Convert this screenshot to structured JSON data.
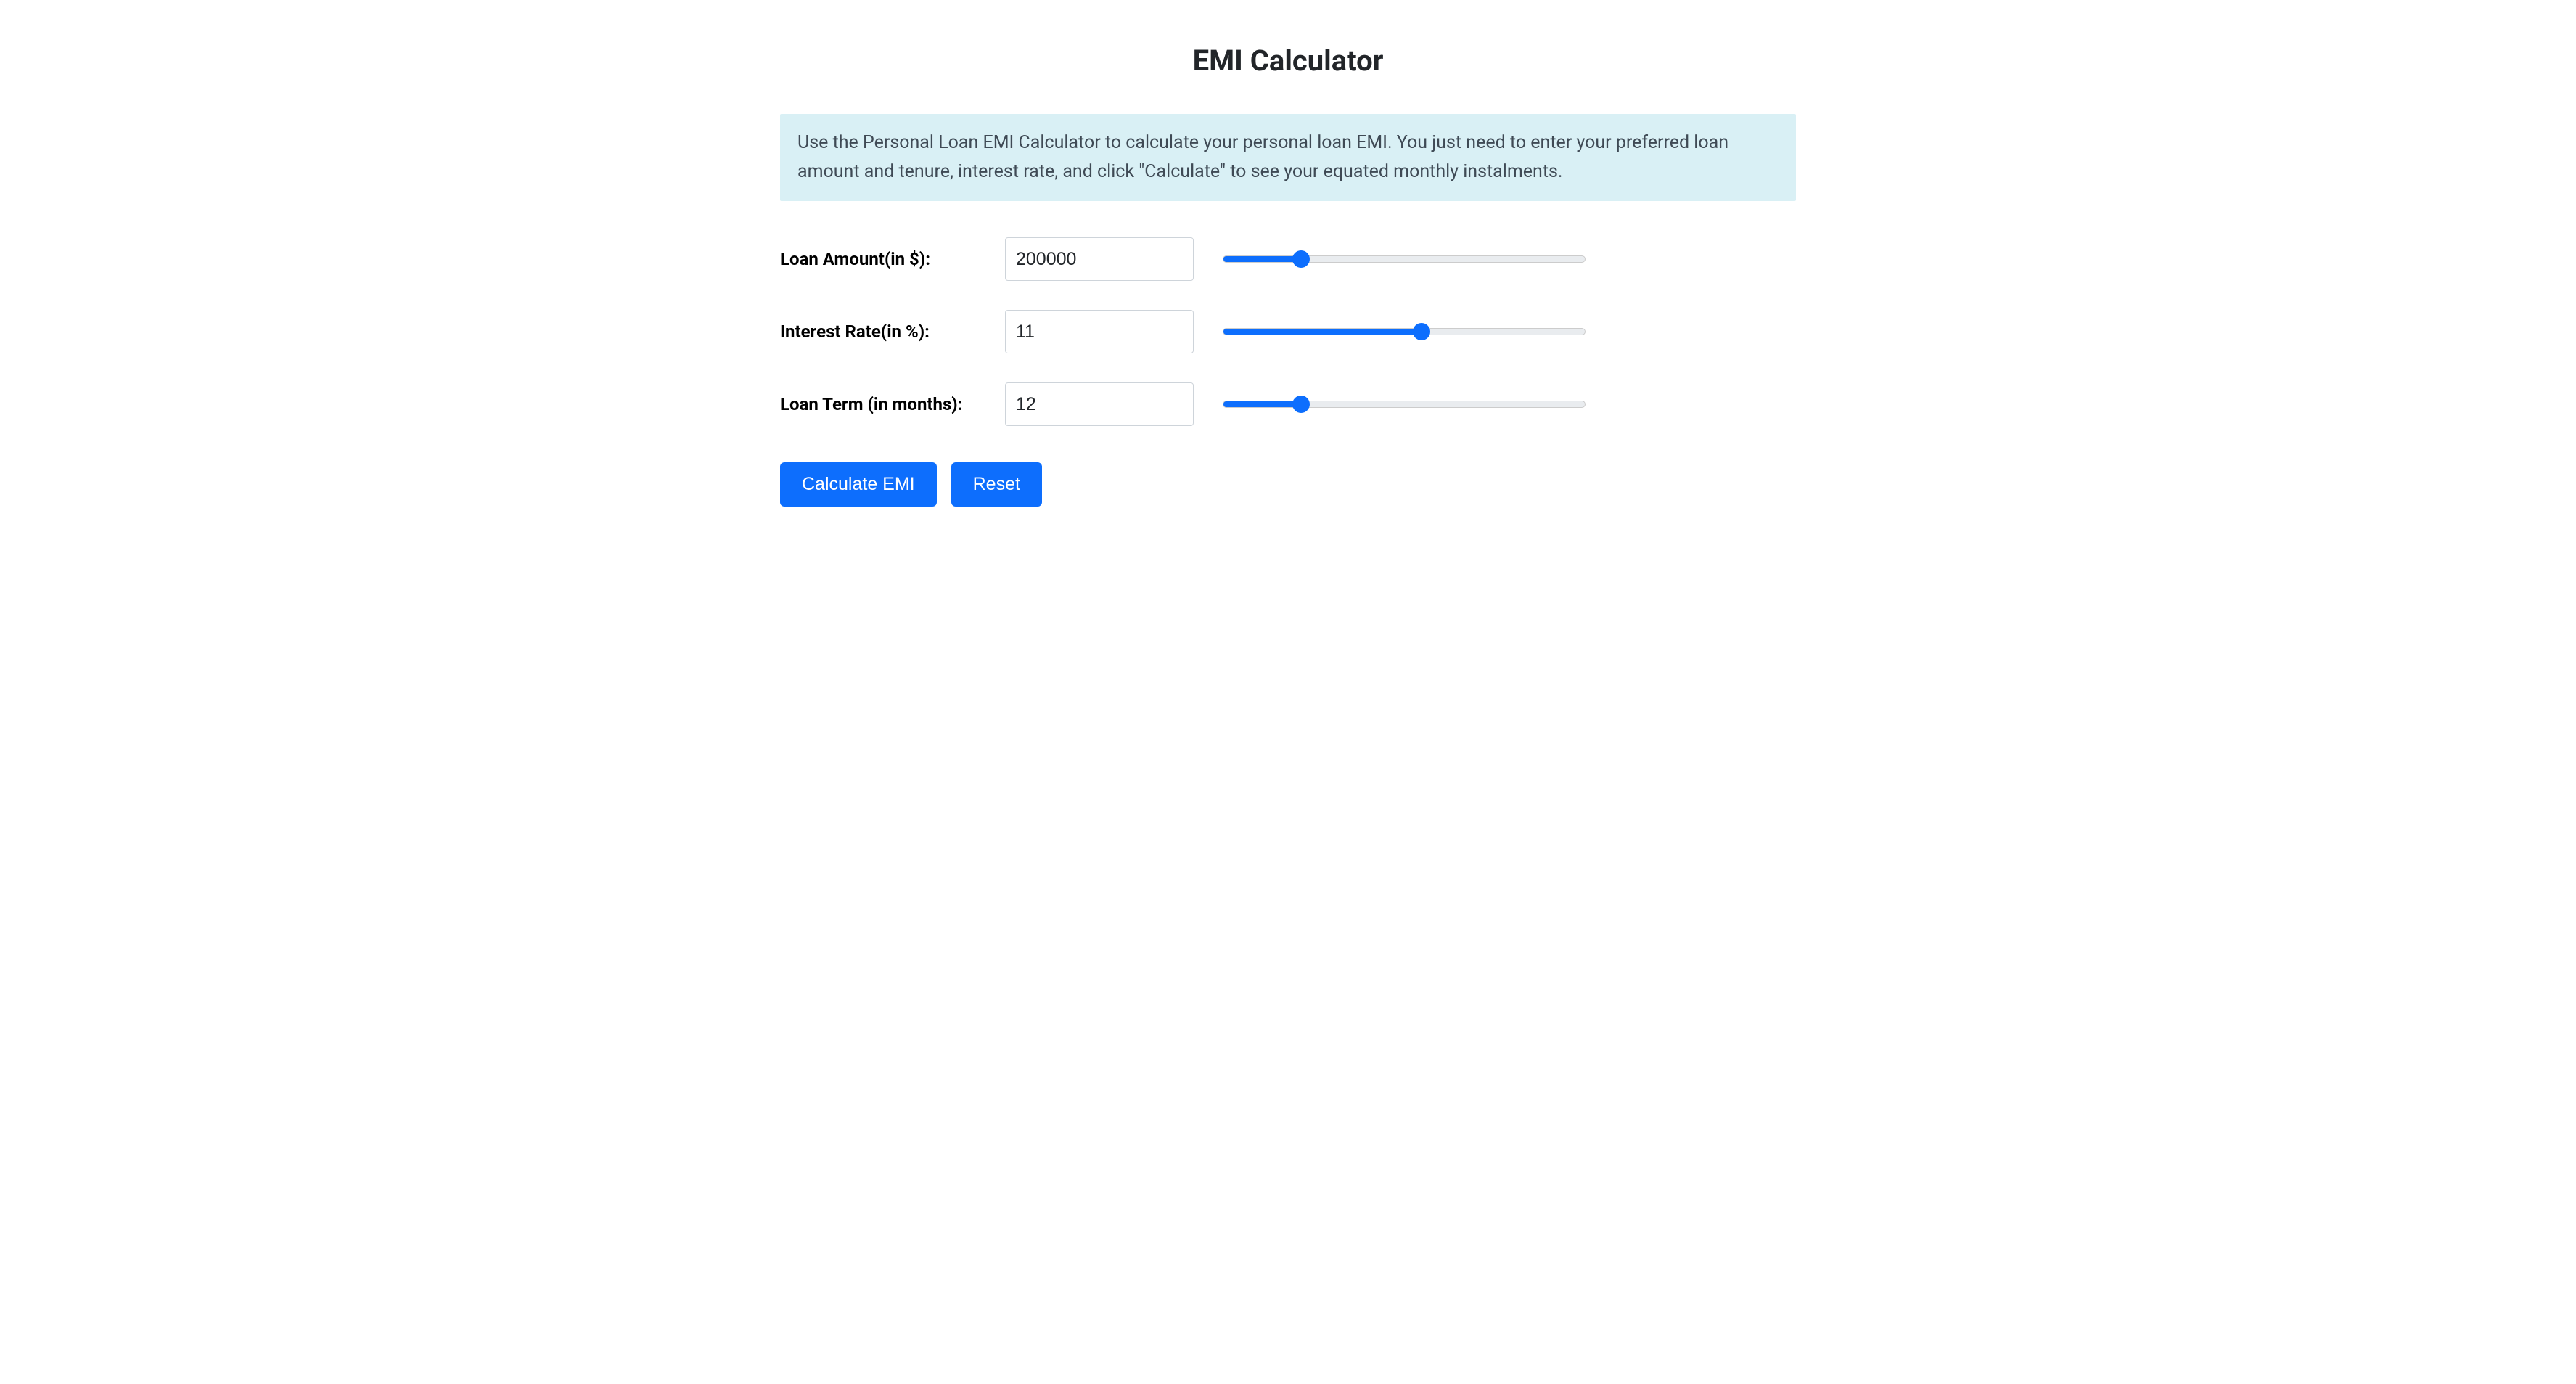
{
  "title": "EMI Calculator",
  "description": "Use the Personal Loan EMI Calculator to calculate your personal loan EMI. You just need to enter your preferred loan amount and tenure, interest rate, and click \"Calculate\" to see your equated monthly instalments.",
  "fields": {
    "loan_amount": {
      "label": "Loan Amount(in $):",
      "value": "200000",
      "slider": {
        "min": 0,
        "max": 1000000,
        "value": 200000
      }
    },
    "interest_rate": {
      "label": "Interest Rate(in %):",
      "value": "11",
      "slider": {
        "min": 0,
        "max": 20,
        "value": 11
      }
    },
    "loan_term": {
      "label": "Loan Term (in months):",
      "value": "12",
      "slider": {
        "min": 0,
        "max": 60,
        "value": 12
      }
    }
  },
  "buttons": {
    "calculate": "Calculate EMI",
    "reset": "Reset"
  },
  "colors": {
    "accent": "#0d6efd",
    "track": "#e9ecef"
  }
}
